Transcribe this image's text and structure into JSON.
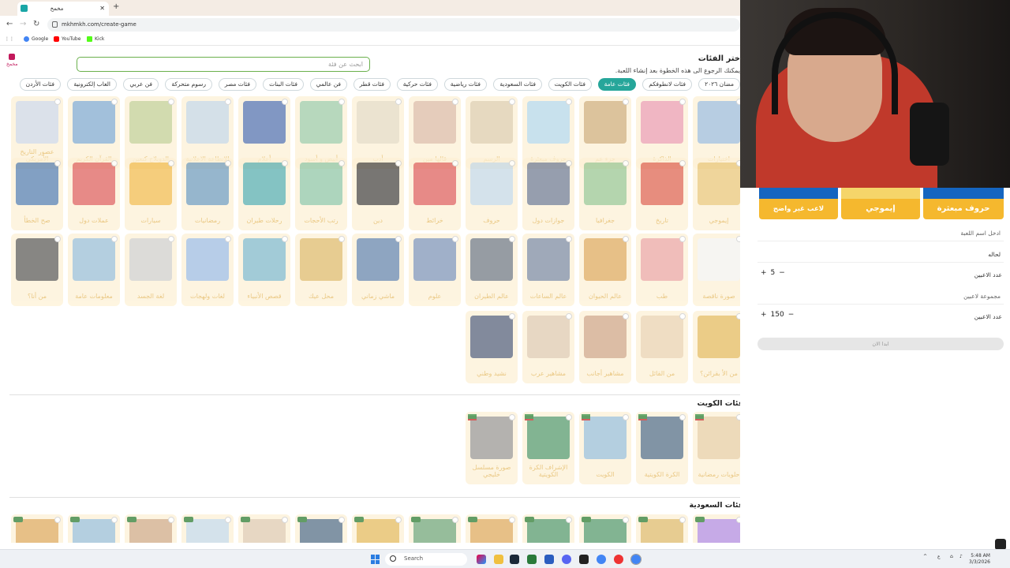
{
  "browser": {
    "tab_title": "مخمخ",
    "url": "mkhmkh.com/create-game",
    "bookmarks": [
      {
        "label": "Google",
        "color": "#4285f4"
      },
      {
        "label": "YouTube",
        "color": "#ff0000"
      },
      {
        "label": "Kick",
        "color": "#53fc18"
      }
    ]
  },
  "side": {
    "logo_text": "مخمخ"
  },
  "header": {
    "title": "ختر الفئات",
    "subtitle": "يمكنك الرجوع الى هذه الخطوة بعد إنشاء اللعبة.",
    "search_placeholder": "ابحث عن فئة"
  },
  "pills": [
    {
      "label": "مضان ٢٠٢٦",
      "active": false
    },
    {
      "label": "فئات لانطوفكم",
      "active": false
    },
    {
      "label": "فئات عامة",
      "active": true
    },
    {
      "label": "فئات الكويت",
      "active": false
    },
    {
      "label": "فئات السعودية",
      "active": false
    },
    {
      "label": "فئات رياضية",
      "active": false
    },
    {
      "label": "فئات حركية",
      "active": false
    },
    {
      "label": "فئات قطر",
      "active": false
    },
    {
      "label": "فن عالمي",
      "active": false
    },
    {
      "label": "فئات البنات",
      "active": false
    },
    {
      "label": "فئات مصر",
      "active": false
    },
    {
      "label": "رسوم متحركة",
      "active": false
    },
    {
      "label": "فن عربي",
      "active": false
    },
    {
      "label": "العاب إلكترونية",
      "active": false
    },
    {
      "label": "فئات الأردن",
      "active": false
    }
  ],
  "general_rows": [
    [
      "اختيارات",
      "الذاكرة",
      "جزء عم",
      "حروف مبعثرة",
      "الرسم",
      "قالها مين",
      "أدب",
      "أبيض و أسود",
      "أعلام",
      "الإنطاعة الاعلانية",
      "الدوبلاج كنعين",
      "القرآن الكريم",
      "عصور التاريخ الأمريكي"
    ],
    [
      "إيموجي",
      "تاريخ",
      "جغرافيا",
      "جوازات دول",
      "حروف",
      "خرائط",
      "دين",
      "رتب الأحجات",
      "رحلات طيران",
      "رمضانيات",
      "سيارات",
      "عملات دول",
      "صح الخطأ"
    ],
    [
      "صورة ناقصة",
      "طب",
      "عالم الحيوان",
      "عالم الساعات",
      "عالم الطيران",
      "علوم",
      "ماشي زماني",
      "محل عيك",
      "قصص الأنبياء",
      "لغات ولهجات",
      "لغة الجسد",
      "معلومات عامة",
      "من أنا؟"
    ],
    [
      "من الأ بقرائن؟",
      "من القائل",
      "مشاهير أجانب",
      "مشاهير عرب",
      "نشيد وطني"
    ]
  ],
  "general_colors": [
    [
      "#8fb4d9",
      "#e88fa8",
      "#c9a56b",
      "#a9d3ea",
      "#d8c7a5",
      "#d7b39c",
      "#e0d6bd",
      "#8ec6a0",
      "#3b5fa8",
      "#bcd1e3",
      "#b9c98a",
      "#6fa0cf",
      "#c7d3e6"
    ],
    [
      "#e6c06a",
      "#d94f3d",
      "#8bbf88",
      "#5a6a88",
      "#bcd5e8",
      "#d94b4b",
      "#2b2b2b",
      "#7fbf9f",
      "#3fa3a9",
      "#5c8fb8",
      "#f0b43a",
      "#d94b4b",
      "#3c6da8"
    ],
    [
      "#f2f2f2",
      "#e79b9b",
      "#d9a04a",
      "#6a7b99",
      "#5a6677",
      "#6b86b3",
      "#4f74a6",
      "#d9b25a",
      "#6fb0c8",
      "#8fb4e3",
      "#c9c9c9",
      "#8ab6d6",
      "#444444"
    ],
    [
      "#e0b24a",
      "#e6cda8",
      "#c99a7a",
      "#d9c3a8",
      "#3c4a6b"
    ]
  ],
  "kuwait_section": {
    "title": "فئات الكويت",
    "cards": [
      "حلويات رمضانية",
      "الكرة الكويتية",
      "الكويت",
      "الإشراف الكرة الكويتية",
      "صورة مسلسل خليجي"
    ],
    "colors": [
      "#e3c89a",
      "#3b5a7a",
      "#8ab6d6",
      "#3c8c5c",
      "#8a8a8a"
    ]
  },
  "saudi_section": {
    "title": "فئات السعودية",
    "colors": [
      "#a77de0",
      "#d9b25a",
      "#3c8c5c",
      "#3c8c5c",
      "#d9a04a",
      "#5a9a6a",
      "#e0b24a",
      "#3b5a7a",
      "#d9c3a8",
      "#bcd5e8",
      "#c9a07a",
      "#8ab6d6",
      "#d9a04a"
    ]
  },
  "panel": {
    "cards": [
      "حروف مبعثرة",
      "إيموجي",
      "لاعب غير واضح"
    ],
    "game_name_placeholder": "ادخل اسم اللعبة",
    "mode_label": "لحاله",
    "players_label": "عدد الاعبين",
    "players_value": "5",
    "group_placeholder": "مجموعة لاعبين",
    "players2_label": "عدد الاعبين",
    "players2_value": "150",
    "start_label": "ابدا الان"
  },
  "taskbar": {
    "search_label": "Search",
    "time": "5:48 AM",
    "date": "3/3/2026",
    "tray_label": "ع"
  }
}
